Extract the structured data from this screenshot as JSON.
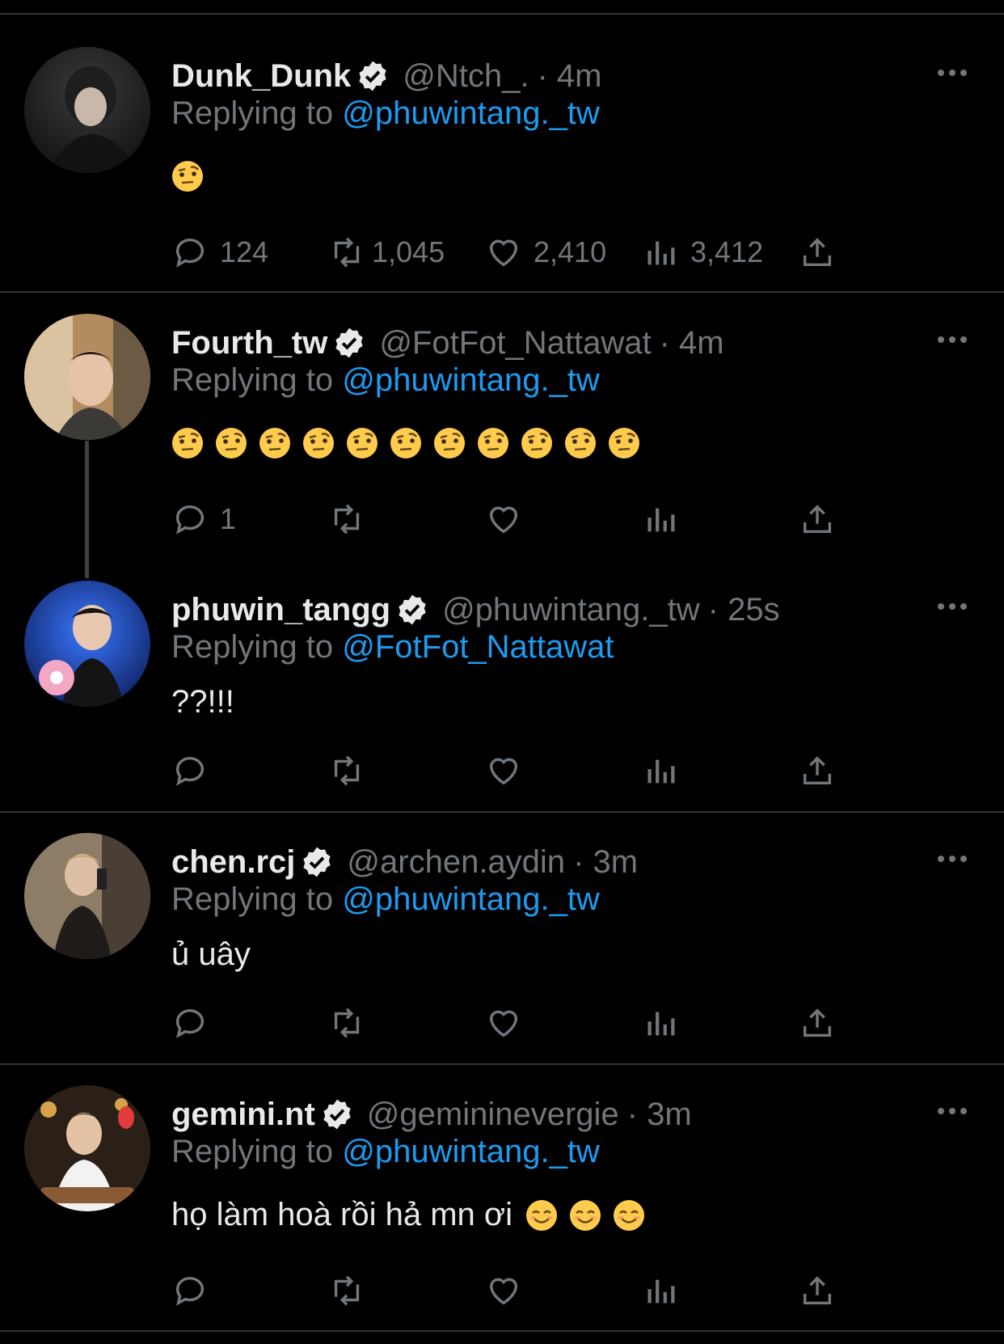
{
  "tweets": [
    {
      "name": "Dunk_Dunk",
      "handle": "@Ntch_.",
      "time": "· 4m",
      "replying_prefix": "Replying to ",
      "replying_to": "@phuwintang._tw",
      "text": "",
      "emoji_count": 1,
      "counts": {
        "reply": "124",
        "retweet": "1,045",
        "like": "2,410",
        "views": "3,412"
      },
      "avatar_colors": [
        "#3a3b3c",
        "#151515"
      ]
    },
    {
      "name": "Fourth_tw",
      "handle": "@FotFot_Nattawat",
      "time": "· 4m",
      "replying_prefix": "Replying to ",
      "replying_to": "@phuwintang._tw",
      "text": "",
      "emoji_count": 11,
      "counts": {
        "reply": "1",
        "retweet": "",
        "like": "",
        "views": ""
      },
      "avatar_colors": [
        "#c9a070",
        "#6d5a44"
      ]
    },
    {
      "name": "phuwin_tangg",
      "handle": "@phuwintang._tw",
      "time": "· 25s",
      "replying_prefix": "Replying to ",
      "replying_to": "@FotFot_Nattawat",
      "text": "??!!!",
      "emoji_count": 0,
      "counts": {
        "reply": "",
        "retweet": "",
        "like": "",
        "views": ""
      },
      "avatar_colors": [
        "#2c5fd6",
        "#0b1a55"
      ]
    },
    {
      "name": "chen.rcj",
      "handle": "@archen.aydin",
      "time": "· 3m",
      "replying_prefix": "Replying to ",
      "replying_to": "@phuwintang._tw",
      "text": "ủ uây",
      "emoji_count": 0,
      "counts": {
        "reply": "",
        "retweet": "",
        "like": "",
        "views": ""
      },
      "avatar_colors": [
        "#9a8a74",
        "#3c3128"
      ]
    },
    {
      "name": "gemini.nt",
      "handle": "@gemininevergie",
      "time": "· 3m",
      "replying_prefix": "Replying to ",
      "replying_to": "@phuwintang._tw",
      "text": "họ làm hoà rồi hả mn ơi",
      "emoji_count": 3,
      "counts": {
        "reply": "",
        "retweet": "",
        "like": "",
        "views": ""
      },
      "avatar_colors": [
        "#a37a46",
        "#2b2018"
      ]
    }
  ],
  "colors": {
    "background": "#000000",
    "text": "#e7e9ea",
    "secondary": "#71767b",
    "link": "#1d9bf0",
    "divider": "#2f3336",
    "emoji_face": "#ffcb4c"
  },
  "icons": {
    "reply": "reply-icon",
    "retweet": "retweet-icon",
    "like": "heart-icon",
    "views": "views-icon",
    "share": "share-icon",
    "more": "more-icon",
    "verified": "verified-badge-icon",
    "emoji_1": "face-with-raised-eyebrow-emoji",
    "emoji_5": "smiling-face-with-smiling-eyes-emoji"
  }
}
